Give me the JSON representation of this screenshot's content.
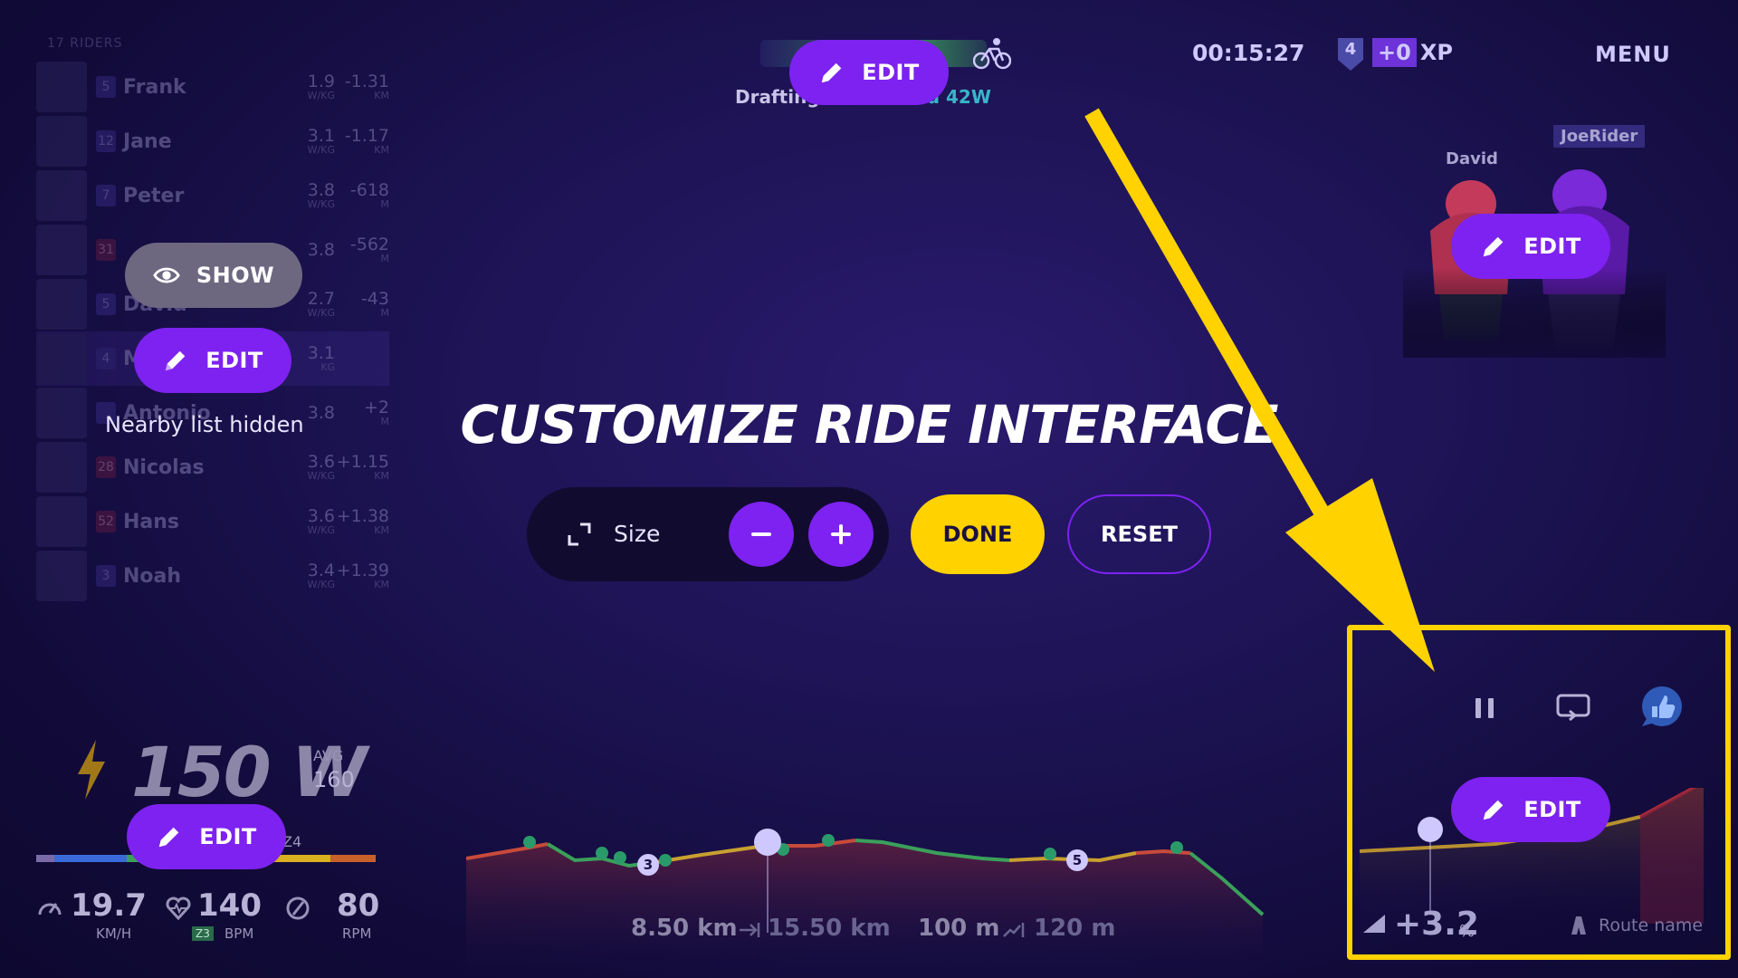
{
  "nearby": {
    "count_label": "17 RIDERS",
    "riders": [
      {
        "level": "5",
        "name": "Frank",
        "wkg": "1.9",
        "wkg_unit": "W/KG",
        "gap": "-1.31",
        "gap_unit": "KM"
      },
      {
        "level": "12",
        "name": "Jane",
        "wkg": "3.1",
        "wkg_unit": "W/KG",
        "gap": "-1.17",
        "gap_unit": "KM"
      },
      {
        "level": "7",
        "name": "Peter",
        "wkg": "3.8",
        "wkg_unit": "W/KG",
        "gap": "-618",
        "gap_unit": "M"
      },
      {
        "level": "31",
        "name": "",
        "wkg": "3.8",
        "wkg_unit": "",
        "gap": "-562",
        "gap_unit": "M"
      },
      {
        "level": "5",
        "name": "David",
        "wkg": "2.7",
        "wkg_unit": "W/KG",
        "gap": "-43",
        "gap_unit": "M"
      },
      {
        "level": "4",
        "name": "M",
        "wkg": "3.1",
        "wkg_unit": "KG",
        "gap": "",
        "gap_unit": ""
      },
      {
        "level": "",
        "name": "Antonio",
        "wkg": "3.8",
        "wkg_unit": "",
        "gap": "+2",
        "gap_unit": "M"
      },
      {
        "level": "28",
        "name": "Nicolas",
        "wkg": "3.6",
        "wkg_unit": "W/KG",
        "gap": "+1.15",
        "gap_unit": "KM"
      },
      {
        "level": "52",
        "name": "Hans",
        "wkg": "3.6",
        "wkg_unit": "W/KG",
        "gap": "+1.38",
        "gap_unit": "KM"
      },
      {
        "level": "3",
        "name": "Noah",
        "wkg": "3.4",
        "wkg_unit": "W/KG",
        "gap": "+1.39",
        "gap_unit": "KM"
      }
    ],
    "show_label": "SHOW",
    "edit_label": "EDIT",
    "hidden_label": "Nearby list hidden"
  },
  "top": {
    "edit_label": "EDIT",
    "drafting_label": "Drafting",
    "drafting_value": "od 42W",
    "timer": "00:15:27",
    "level": "4",
    "xp_plus": "+0",
    "xp_label": "XP",
    "menu": "MENU"
  },
  "riders_view": {
    "name_left": "David",
    "name_right": "JoeRider",
    "edit_label": "EDIT"
  },
  "customize": {
    "title": "CUSTOMIZE RIDE INTERFACE",
    "size_label": "Size",
    "done_label": "DONE",
    "reset_label": "RESET"
  },
  "power": {
    "value": "150 W",
    "avg_label": "AVG",
    "avg_value": "160",
    "zone_label": "Z4",
    "edit_label": "EDIT",
    "speed": "19.7",
    "speed_unit": "KM/H",
    "hr": "140",
    "hr_zone": "Z3",
    "hr_unit": "BPM",
    "cadence": "80",
    "cadence_unit": "RPM",
    "zone_colors": [
      "#7a6aa8",
      "#3a6ad8",
      "#3aa05a",
      "#d8b020",
      "#c8602a"
    ]
  },
  "profile": {
    "distance_done": "8.50 km",
    "distance_total": "15.50 km",
    "elev_done": "100 m",
    "elev_total": "120 m",
    "marker_a": "3",
    "marker_b": "5"
  },
  "minimap": {
    "edit_label": "EDIT",
    "grade": "+3.2",
    "grade_unit": "%",
    "route_name": "Route name"
  },
  "colors": {
    "accent": "#7d22f0",
    "done": "#ffd200",
    "highlight": "#ffd200"
  }
}
